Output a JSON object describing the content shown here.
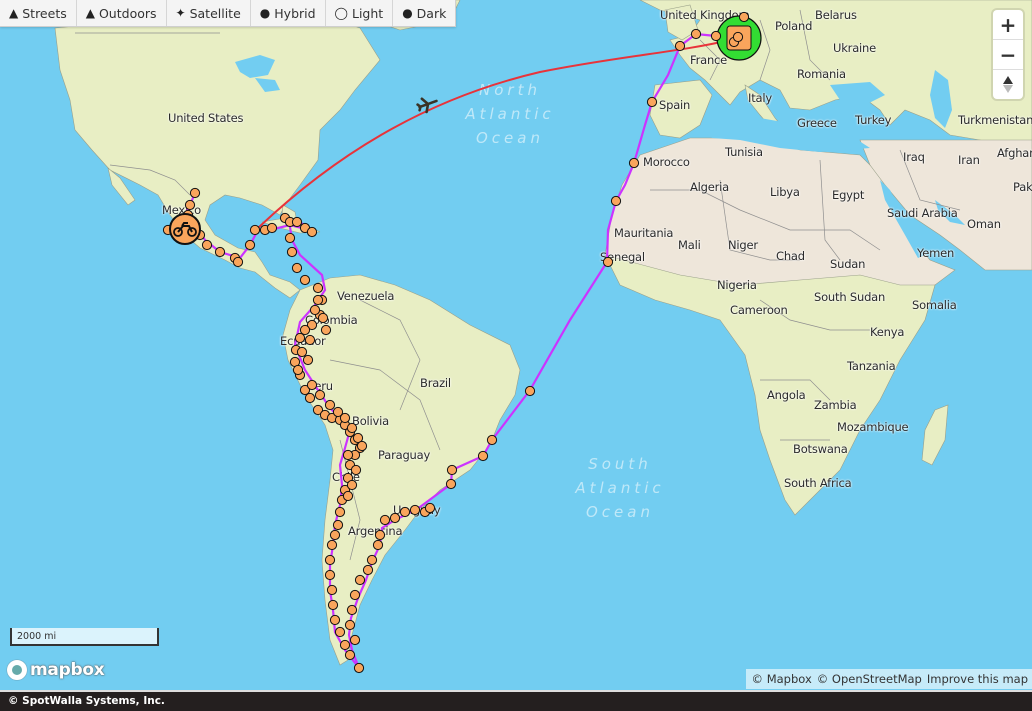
{
  "map_styles": [
    {
      "label": "Streets",
      "icon": "road-icon",
      "glyph": "➖"
    },
    {
      "label": "Outdoors",
      "icon": "mountain-icon",
      "glyph": "▲"
    },
    {
      "label": "Satellite",
      "icon": "satellite-icon",
      "glyph": "✦"
    },
    {
      "label": "Hybrid",
      "icon": "hybrid-icon",
      "glyph": "◆"
    },
    {
      "label": "Light",
      "icon": "lightbulb-icon",
      "glyph": "♡"
    },
    {
      "label": "Dark",
      "icon": "dark-bulb-icon",
      "glyph": "●"
    }
  ],
  "zoom_controls": {
    "zoom_in": "+",
    "zoom_out": "−"
  },
  "scale": {
    "label": "2000 mi"
  },
  "brand": {
    "logo_text": "mapbox"
  },
  "attribution": {
    "mapbox": "© Mapbox",
    "osm": "© OpenStreetMap",
    "improve": "Improve this map"
  },
  "footer": {
    "copyright": "© SpotWalla Systems, Inc."
  },
  "oceans": [
    {
      "name": "North Atlantic Ocean",
      "lines": [
        "North",
        "Atlantic",
        "Ocean"
      ]
    },
    {
      "name": "South Atlantic Ocean",
      "lines": [
        "South",
        "Atlantic",
        "Ocean"
      ]
    }
  ],
  "country_labels": [
    "United States",
    "Mexico",
    "Venezuela",
    "Colombia",
    "Ecuador",
    "Peru",
    "Brazil",
    "Bolivia",
    "Paraguay",
    "Chile",
    "Uruguay",
    "Argentina",
    "United Kingdom",
    "France",
    "Spain",
    "Italy",
    "Poland",
    "Belarus",
    "Ukraine",
    "Romania",
    "Greece",
    "Turkey",
    "Turkmenistan",
    "Afghanistan",
    "Iraq",
    "Iran",
    "Pakistan",
    "Saudi Arabia",
    "Oman",
    "Yemen",
    "Morocco",
    "Algeria",
    "Tunisia",
    "Libya",
    "Egypt",
    "Mauritania",
    "Mali",
    "Niger",
    "Chad",
    "Sudan",
    "Senegal",
    "Nigeria",
    "Cameroon",
    "South Sudan",
    "Somalia",
    "Kenya",
    "Tanzania",
    "Angola",
    "Zambia",
    "Mozambique",
    "Botswana",
    "South Africa"
  ],
  "markers": {
    "current_position": "motorcycle-icon",
    "flight": "airplane-icon",
    "start_cluster": "home-cluster"
  },
  "colors": {
    "track_line": "#cc33ff",
    "flight_line": "#e8333a",
    "waypoint_fill": "#f9a55c",
    "cluster_ring": "#33dd33",
    "water": "#72cdf1",
    "land": "#e8eec4"
  }
}
